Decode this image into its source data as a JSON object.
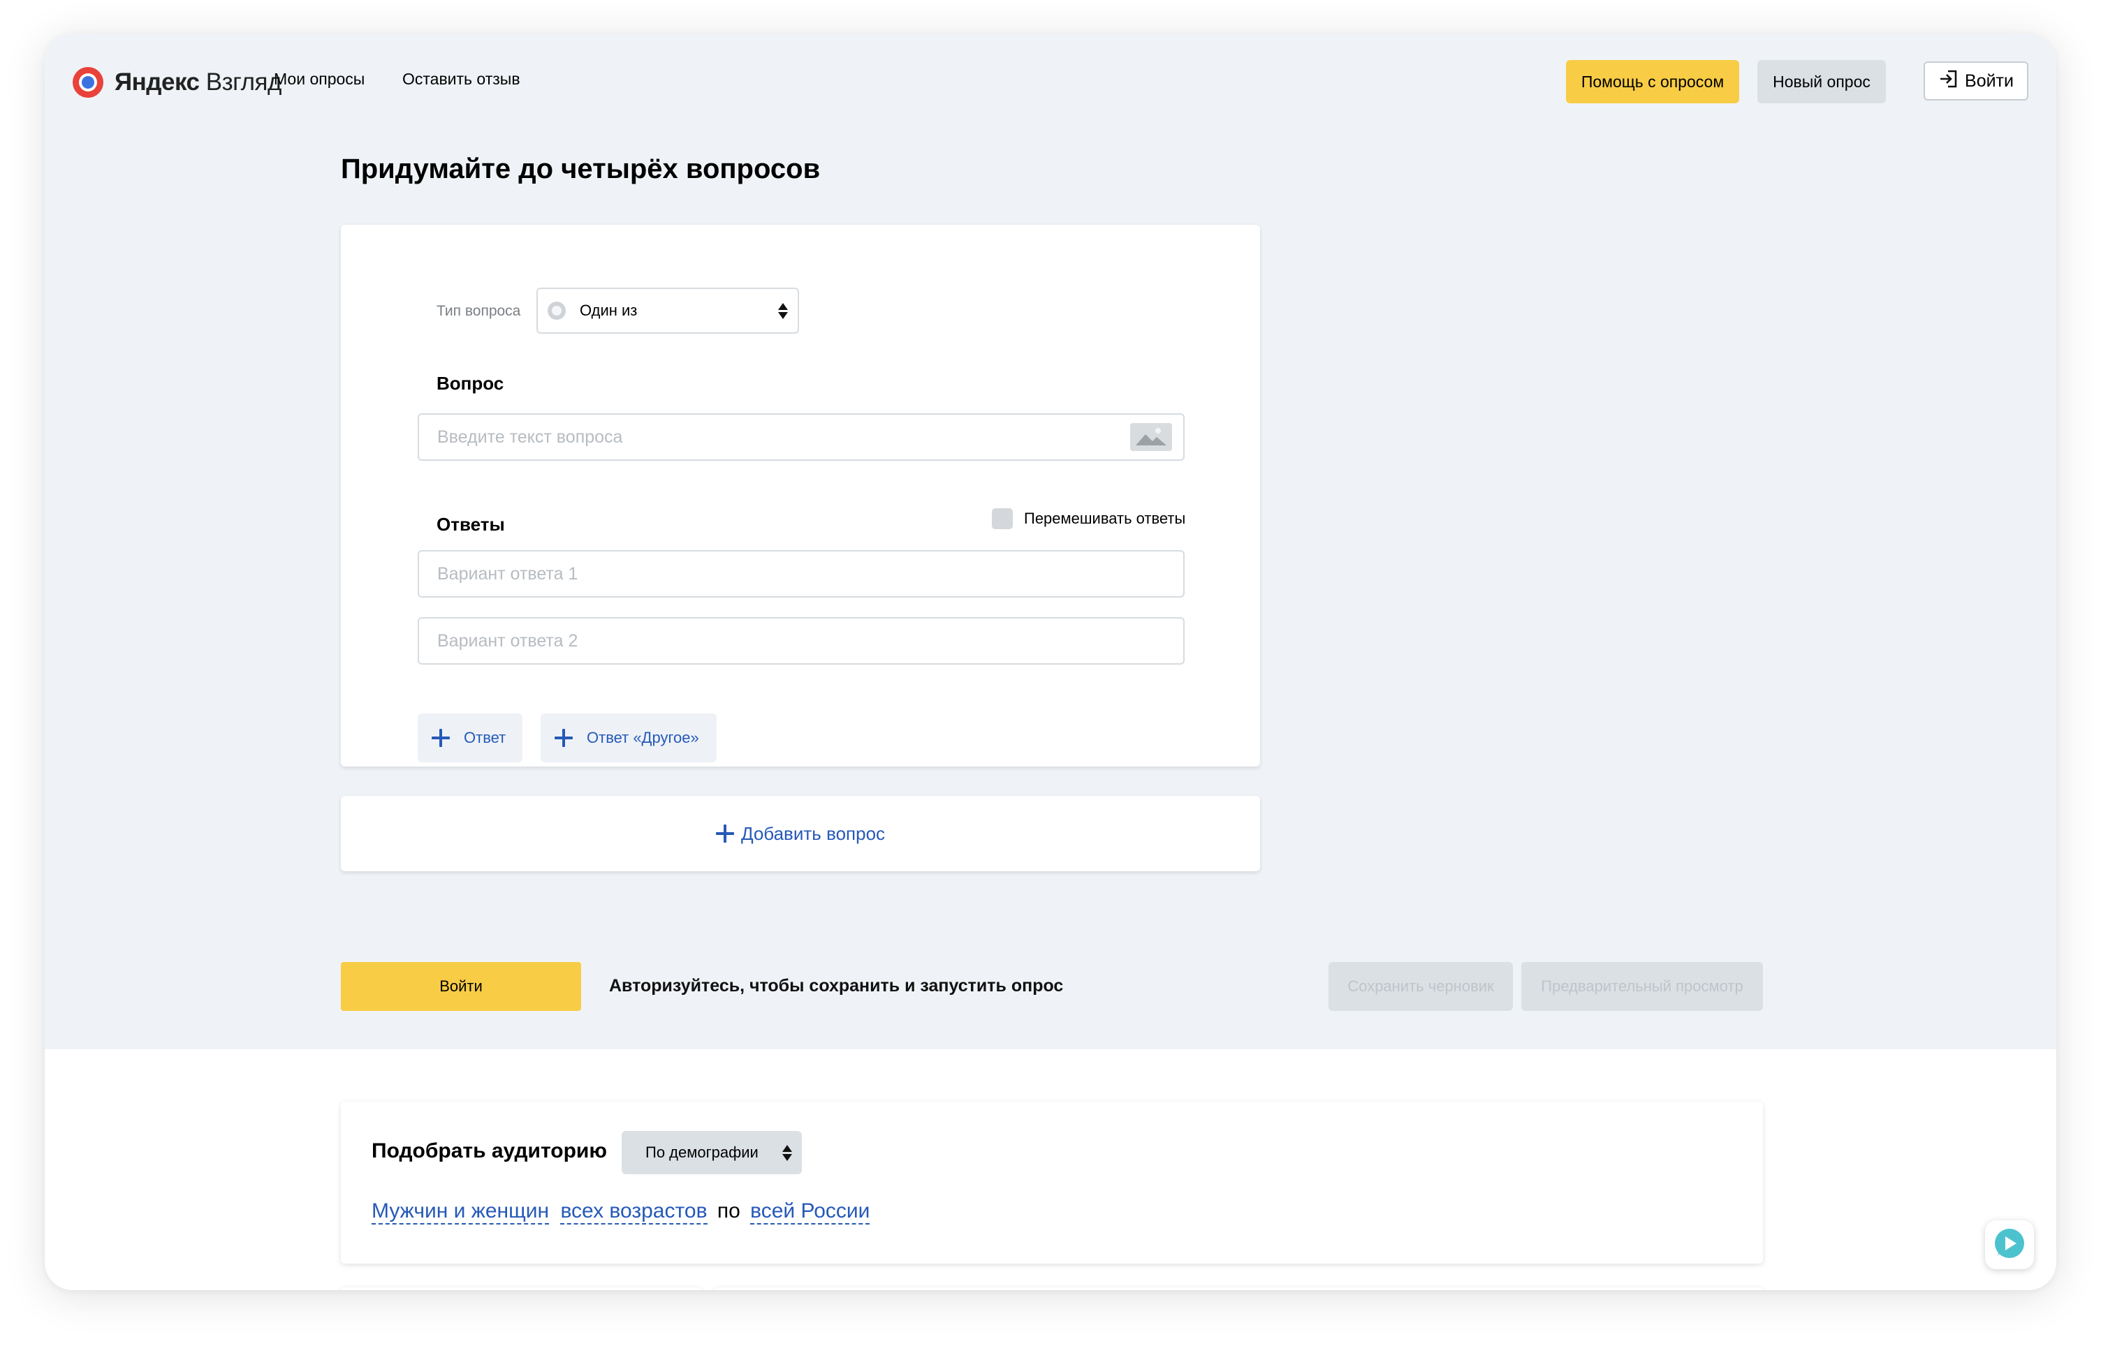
{
  "header": {
    "logo_brand": "Яндекс",
    "logo_product": "Взгляд",
    "nav": [
      "Мои опросы",
      "Оставить отзыв"
    ],
    "help_button": "Помощь с опросом",
    "new_poll_button": "Новый опрос",
    "login_button": "Войти"
  },
  "page_title": "Придумайте до четырёх вопросов",
  "question_card": {
    "type_label": "Тип вопроса",
    "type_value": "Один из",
    "question_label": "Вопрос",
    "question_placeholder": "Введите текст вопроса",
    "answers_label": "Ответы",
    "shuffle_label": "Перемешивать ответы",
    "shuffle_checked": false,
    "answer_placeholders": [
      "Вариант ответа 1",
      "Вариант ответа 2"
    ],
    "add_answer": "Ответ",
    "add_other_answer": "Ответ «Другое»"
  },
  "add_question": "Добавить вопрос",
  "actions": {
    "login": "Войти",
    "auth_message": "Авторизуйтесь, чтобы сохранить и запустить опрос",
    "save_draft": "Сохранить черновик",
    "preview": "Предварительный просмотр"
  },
  "audience": {
    "title": "Подобрать аудиторию",
    "select_value": "По демографии",
    "gender": "Мужчин и женщин",
    "age": "всех возрастов",
    "connector": "по",
    "region": "всей России"
  },
  "colors": {
    "accent_yellow": "#f8cc45",
    "link_blue": "#2659b8",
    "page_bg": "#eff3f7",
    "button_gray": "#dbe0e5"
  },
  "icons": [
    "yandex-logo-icon",
    "login-icon",
    "radio-icon",
    "sort-arrows-icon",
    "image-icon",
    "plus-icon",
    "chat-icon"
  ]
}
